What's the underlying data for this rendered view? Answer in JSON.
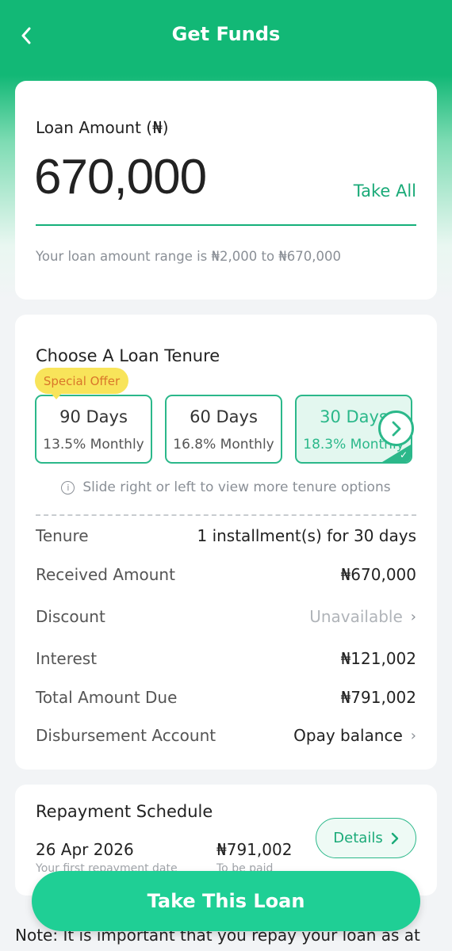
{
  "header": {
    "title": "Get Funds"
  },
  "loan": {
    "label": "Loan Amount (₦)",
    "amount": "670,000",
    "take_all": "Take All",
    "range_text": "Your loan amount range is ₦2,000 to ₦670,000"
  },
  "tenure": {
    "title": "Choose A Loan Tenure",
    "special_offer": "Special Offer",
    "options": [
      {
        "days": "90 Days",
        "rate": "13.5% Monthly"
      },
      {
        "days": "60 Days",
        "rate": "16.8% Monthly"
      },
      {
        "days": "30 Days",
        "rate": "18.3% Monthly"
      }
    ],
    "hint": "Slide right or left to view more tenure options"
  },
  "details": {
    "tenure_label": "Tenure",
    "tenure_value": "1 installment(s) for 30 days",
    "received_label": "Received Amount",
    "received_value": "₦670,000",
    "discount_label": "Discount",
    "discount_value": "Unavailable",
    "interest_label": "Interest",
    "interest_value": "₦121,002",
    "total_label": "Total Amount Due",
    "total_value": "₦791,002",
    "account_label": "Disbursement Account",
    "account_value": "Opay balance"
  },
  "repayment": {
    "title": "Repayment Schedule",
    "date": "26 Apr 2026",
    "date_sub": "Your first repayment date",
    "amount": "₦791,002",
    "amount_sub": "To be paid",
    "details_button": "Details"
  },
  "cta": {
    "take_loan": "Take This Loan"
  },
  "note": "Note: It is important that you repay your loan as at",
  "colors": {
    "brand": "#12b876",
    "accent": "#2bb88a",
    "button": "#1fcf95"
  }
}
